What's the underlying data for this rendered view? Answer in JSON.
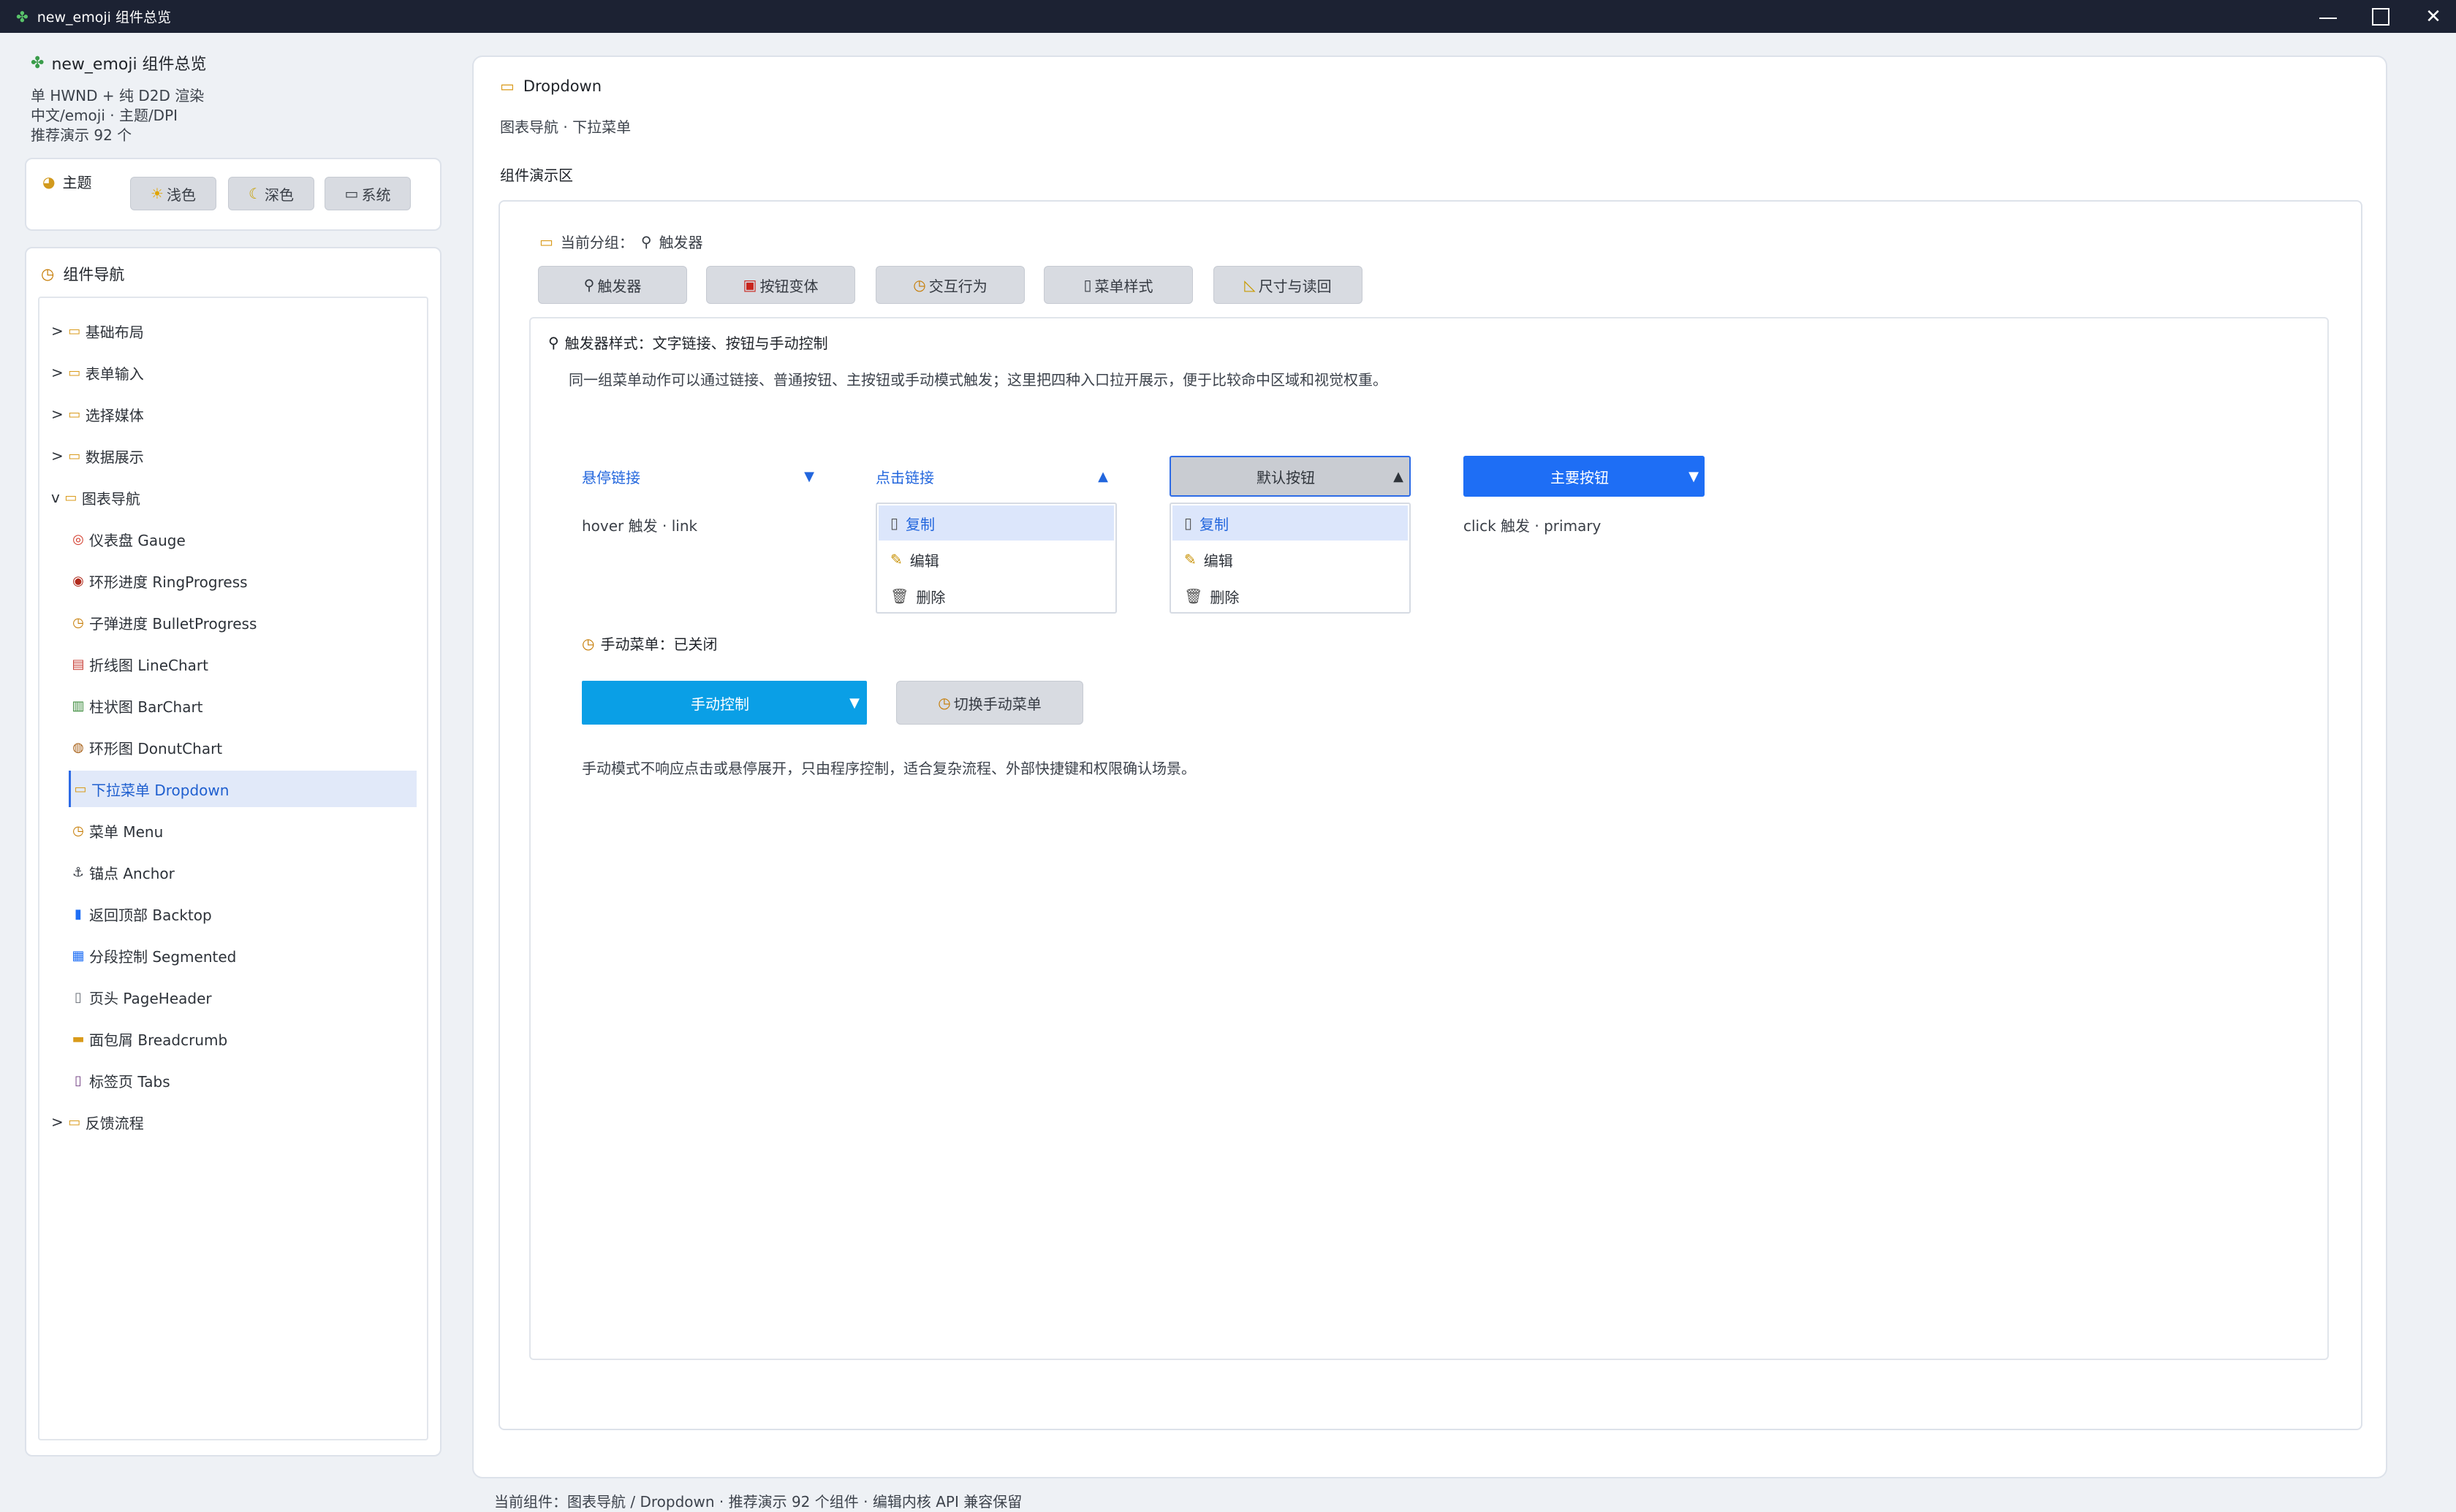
{
  "window": {
    "title": "new_emoji 组件总览",
    "app_icon": "clover-icon"
  },
  "sidebar": {
    "app_name": "new_emoji 组件总览",
    "info_lines": [
      "单 HWND + 纯 D2D 渲染",
      "中文/emoji · 主题/DPI",
      "推荐演示 92 个"
    ],
    "theme": {
      "label": "主题",
      "buttons": [
        {
          "glyph": "☀",
          "label": "浅色"
        },
        {
          "glyph": "☾",
          "label": "深色"
        },
        {
          "glyph": "▭",
          "label": "系统"
        }
      ]
    },
    "nav": {
      "title": "组件导航",
      "items": [
        {
          "prefix": ">",
          "glyph": "▭",
          "label": "基础布局"
        },
        {
          "prefix": ">",
          "glyph": "▭",
          "label": "表单输入"
        },
        {
          "prefix": ">",
          "glyph": "▭",
          "label": "选择媒体"
        },
        {
          "prefix": ">",
          "glyph": "▭",
          "label": "数据展示"
        },
        {
          "prefix": "v",
          "glyph": "▭",
          "label": "图表导航"
        },
        {
          "glyph": "◎",
          "label": "仪表盘 Gauge"
        },
        {
          "glyph": "◉",
          "label": "环形进度 RingProgress"
        },
        {
          "glyph": "◷",
          "label": "子弹进度 BulletProgress"
        },
        {
          "glyph": "▤",
          "label": "折线图 LineChart"
        },
        {
          "glyph": "▥",
          "label": "柱状图 BarChart"
        },
        {
          "glyph": "◍",
          "label": "环形图 DonutChart"
        },
        {
          "glyph": "▭",
          "label": "下拉菜单 Dropdown"
        },
        {
          "glyph": "◷",
          "label": "菜单 Menu"
        },
        {
          "glyph": "⚓",
          "label": "锚点 Anchor"
        },
        {
          "glyph": "▮",
          "label": "返回顶部 Backtop"
        },
        {
          "glyph": "▦",
          "label": "分段控制 Segmented"
        },
        {
          "glyph": "▯",
          "label": "页头 PageHeader"
        },
        {
          "glyph": "▬",
          "label": "面包屑 Breadcrumb"
        },
        {
          "glyph": "▯",
          "label": "标签页 Tabs"
        },
        {
          "prefix": ">",
          "glyph": "▭",
          "label": "反馈流程"
        }
      ]
    }
  },
  "main": {
    "title": "Dropdown",
    "subtitle": "图表导航 · 下拉菜单",
    "demo_label": "组件演示区",
    "current_group_label": "当前分组：",
    "current_group_value": "触发器",
    "group_buttons": [
      {
        "glyph": "⚲",
        "label": "触发器"
      },
      {
        "glyph": "▣",
        "label": "按钮变体"
      },
      {
        "glyph": "◷",
        "label": "交互行为"
      },
      {
        "glyph": "▯",
        "label": "菜单样式"
      },
      {
        "glyph": "◺",
        "label": "尺寸与读回"
      }
    ],
    "card": {
      "title": "触发器样式：文字链接、按钮与手动控制",
      "description": "同一组菜单动作可以通过链接、普通按钮、主按钮或手动模式触发；这里把四种入口拉开展示，便于比较命中区域和视觉权重。",
      "hover_link": {
        "label": "悬停链接",
        "caret": "▼",
        "hint": "hover 触发 · link"
      },
      "click_link": {
        "label": "点击链接",
        "caret": "▲"
      },
      "default_button": {
        "label": "默认按钮",
        "caret": "▲"
      },
      "primary_button": {
        "label": "主要按钮",
        "caret": "▼",
        "hint": "click 触发 · primary"
      },
      "menu_items": [
        {
          "glyph": "▯",
          "label": "复制"
        },
        {
          "glyph": "✎",
          "label": "编辑"
        },
        {
          "glyph": "🗑",
          "label": "删除"
        }
      ],
      "manual_status": "手动菜单：已关闭",
      "manual_button": {
        "label": "手动控制",
        "caret": "▼"
      },
      "toggle_button": "切换手动菜单",
      "manual_note": "手动模式不响应点击或悬停展开，只由程序控制，适合复杂流程、外部快捷键和权限确认场景。"
    }
  },
  "status_bar": "当前组件：图表导航 / Dropdown · 推荐演示 92 个组件 · 编辑内核 API 兼容保留",
  "colors": {
    "accent": "#1e6ef5",
    "manual": "#0a9fe6",
    "titlebar": "#1c2233",
    "link": "#2266dd"
  }
}
